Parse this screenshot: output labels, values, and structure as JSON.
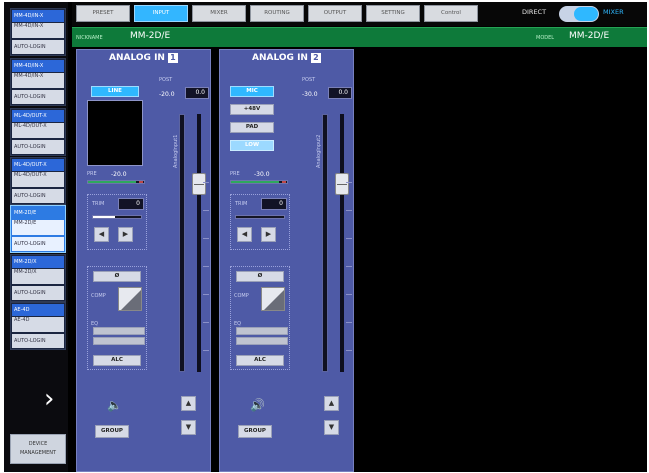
{
  "sidebar": {
    "devices": [
      {
        "line1": "MM-4D/IN-X",
        "line2": "MM-4D/IN-X",
        "line3": "AUTO-LOGIN",
        "selected": false
      },
      {
        "line1": "MM-4D/IN-X",
        "line2": "MM-4D/IN-X",
        "line3": "AUTO-LOGIN",
        "selected": false
      },
      {
        "line1": "ML-4D/OUT-X",
        "line2": "ML-4D/OUT-X",
        "line3": "AUTO-LOGIN",
        "selected": false
      },
      {
        "line1": "ML-4D/OUT-X",
        "line2": "ML-4D/OUT-X",
        "line3": "AUTO-LOGIN",
        "selected": false
      },
      {
        "line1": "MM-2D/E",
        "line2": "MM-2D/E",
        "line3": "AUTO-LOGIN",
        "selected": true
      },
      {
        "line1": "MM-2D/X",
        "line2": "MM-2D/X",
        "line3": "AUTO-LOGIN",
        "selected": false
      },
      {
        "line1": "AE-4D",
        "line2": "AE-4D",
        "line3": "AUTO-LOGIN",
        "selected": false
      }
    ],
    "device_mgmt_line1": "DEVICE",
    "device_mgmt_line2": "MANAGEMENT"
  },
  "tabs": [
    {
      "label": "PRESET",
      "active": false
    },
    {
      "label": "INPUT",
      "active": true
    },
    {
      "label": "MIXER",
      "active": false
    },
    {
      "label": "ROUTING",
      "active": false
    },
    {
      "label": "OUTPUT",
      "active": false
    },
    {
      "label": "SETTING",
      "active": false
    },
    {
      "label": "Control",
      "active": false
    }
  ],
  "mode": {
    "direct_label": "DIRECT",
    "mixer_label": "MIXER",
    "value": "MIXER"
  },
  "info": {
    "nickname_label": "NICKNAME",
    "nickname": "MM-2D/E",
    "model_label": "MODEL",
    "model": "MM-2D/E"
  },
  "channels": [
    {
      "title": "ANALOG IN",
      "number": "1",
      "post_label": "POST",
      "post_value1": "-20.0",
      "post_value2": "0.0",
      "input_type_label": "LINE",
      "pre_label": "PRE",
      "pre_value": "-20.0",
      "trim_label": "TRIM",
      "trim_value": "0",
      "trim_level": 0.45,
      "phase_label": "Ø",
      "comp_label": "COMP",
      "eq_label": "EQ",
      "alc_label": "ALC",
      "group_label": "GROUP",
      "fader_name": "AnalogInput1",
      "fader_level": 0.75,
      "muted": true
    },
    {
      "title": "ANALOG IN",
      "number": "2",
      "post_label": "POST",
      "post_value1": "-30.0",
      "post_value2": "0.0",
      "mic_label": "MIC",
      "phantom_label": "+48V",
      "pad_label": "PAD",
      "low_cut_label": "LOW",
      "pre_label": "PRE",
      "pre_value": "-30.0",
      "trim_label": "TRIM",
      "trim_value": "0",
      "trim_level": 0.0,
      "phase_label": "Ø",
      "comp_label": "COMP",
      "eq_label": "EQ",
      "alc_label": "ALC",
      "group_label": "GROUP",
      "fader_name": "AnalogInput2",
      "fader_level": 0.75,
      "muted": false
    }
  ],
  "colors": {
    "strip": "#4e5aa6",
    "accent": "#2fb8ff",
    "info_bar": "#0e7a3a"
  }
}
